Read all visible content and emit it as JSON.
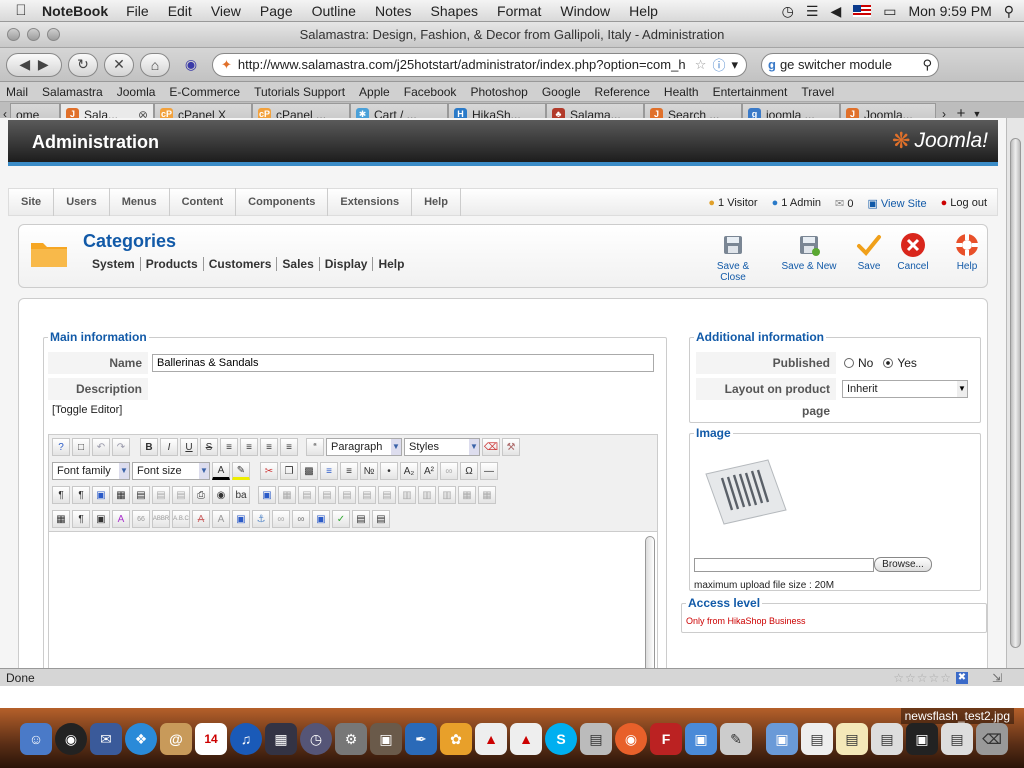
{
  "menubar": {
    "app": "NoteBook",
    "items": [
      "File",
      "Edit",
      "View",
      "Page",
      "Outline",
      "Notes",
      "Shapes",
      "Format",
      "Window",
      "Help"
    ],
    "clock": "Mon 9:59 PM"
  },
  "browser": {
    "title": "Salamastra: Design, Fashion, & Decor from Gallipoli, Italy - Administration",
    "url": "http://www.salamastra.com/j25hotstart/administrator/index.php?option=com_h",
    "search_value": "ge switcher module",
    "bookmarks": [
      "Mail",
      "Salamastra",
      "Joomla",
      "E-Commerce",
      "Tutorials Support",
      "Apple",
      "Facebook",
      "Photoshop",
      "Google",
      "Reference",
      "Health",
      "Entertainment",
      "Travel"
    ],
    "tabs": [
      {
        "label": "ome",
        "favicon": "home"
      },
      {
        "label": "Sala...",
        "favicon": "joomla",
        "active": true
      },
      {
        "label": "cPanel X",
        "favicon": "cpanel"
      },
      {
        "label": "cPanel ...",
        "favicon": "cpanel"
      },
      {
        "label": "Cart / ...",
        "favicon": "star"
      },
      {
        "label": "HikaSh...",
        "favicon": "hika"
      },
      {
        "label": "Salama...",
        "favicon": "tree"
      },
      {
        "label": "Search ...",
        "favicon": "joomla"
      },
      {
        "label": "joomla ...",
        "favicon": "google"
      },
      {
        "label": "Joomla...",
        "favicon": "joomla"
      }
    ],
    "status": "Done"
  },
  "admin": {
    "header_title": "Administration",
    "brand": "Joomla!",
    "menu": [
      "Site",
      "Users",
      "Menus",
      "Content",
      "Components",
      "Extensions",
      "Help"
    ],
    "status": {
      "visitors": "1 Visitor",
      "admins": "1 Admin",
      "messages": "0",
      "view_site": "View Site",
      "logout": "Log out"
    },
    "page_title": "Categories",
    "submenu": [
      "System",
      "Products",
      "Customers",
      "Sales",
      "Display",
      "Help"
    ],
    "toolbar": [
      {
        "label": "Save & Close",
        "icon": "save-close-icon"
      },
      {
        "label": "Save & New",
        "icon": "save-new-icon"
      },
      {
        "label": "Save",
        "icon": "save-check-icon"
      },
      {
        "label": "Cancel",
        "icon": "cancel-icon"
      },
      {
        "label": "Help",
        "icon": "help-lifebuoy-icon"
      }
    ],
    "main_info": {
      "legend": "Main information",
      "name_label": "Name",
      "name_value": "Ballerinas & Sandals",
      "description_label": "Description",
      "toggle_editor": "[Toggle Editor]",
      "format_select": "Paragraph",
      "styles_select": "Styles",
      "font_family_select": "Font family",
      "font_size_select": "Font size"
    },
    "additional_info": {
      "legend": "Additional information",
      "published_label": "Published",
      "published_no": "No",
      "published_yes": "Yes",
      "published_selected": "Yes",
      "layout_label": "Layout on product page",
      "layout_value": "Inherit"
    },
    "image": {
      "legend": "Image",
      "browse_label": "Browse...",
      "max_upload": "maximum upload file size : 20M"
    },
    "access": {
      "legend": "Access level",
      "value": "Only from HikaShop Business"
    }
  },
  "dock": {
    "label": "newsflash_test2.jpg"
  }
}
